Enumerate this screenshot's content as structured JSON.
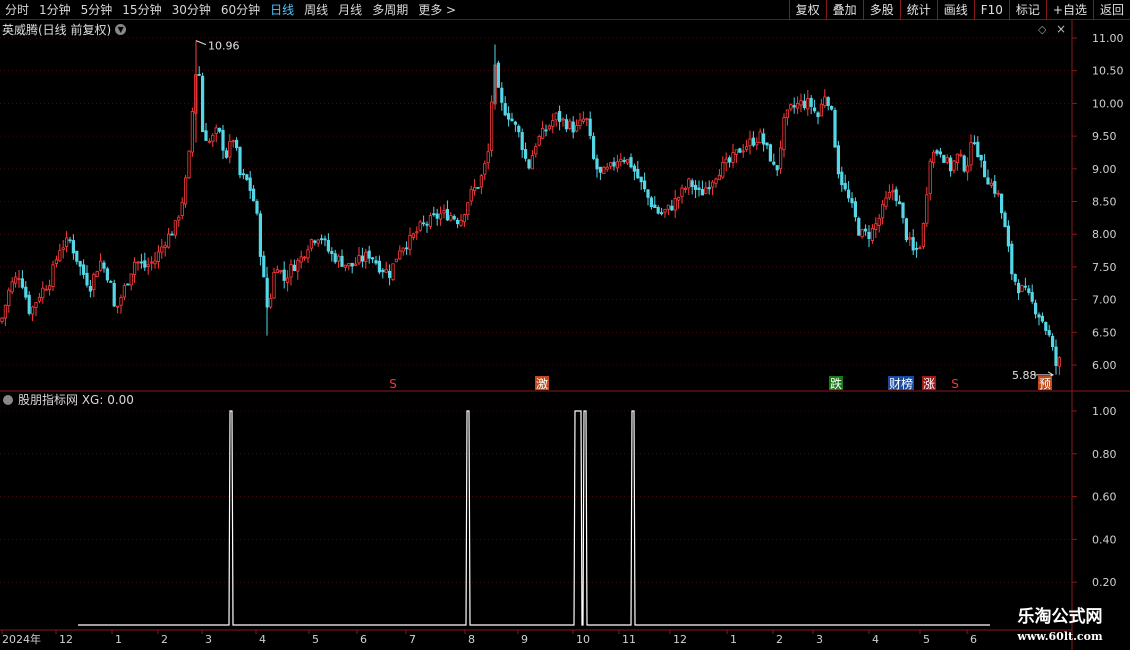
{
  "toolbar": {
    "periods": [
      "分时",
      "1分钟",
      "5分钟",
      "15分钟",
      "30分钟",
      "60分钟",
      "日线",
      "周线",
      "月线",
      "多周期",
      "更多 >"
    ],
    "active_period": "日线",
    "right_buttons": [
      "复权",
      "叠加",
      "多股",
      "统计",
      "画线",
      "F10",
      "标记",
      "+自选",
      "返回"
    ]
  },
  "main_chart": {
    "title": "英威腾(日线 前复权)",
    "y_ticks": [
      "11.00",
      "10.50",
      "10.00",
      "9.50",
      "9.00",
      "8.50",
      "8.00",
      "7.50",
      "7.00",
      "6.50",
      "6.00"
    ],
    "high_label": "10.96",
    "low_label": "5.88",
    "markers": [
      {
        "text": "S",
        "color": "#ff3333",
        "bg": "none"
      },
      {
        "text": "激",
        "color": "#ffffff",
        "bg": "#c04a1a"
      },
      {
        "text": "跌",
        "color": "#ffffff",
        "bg": "#1a7a1a"
      },
      {
        "text": "财榜",
        "color": "#ffffff",
        "bg": "#1a4aa0"
      },
      {
        "text": "涨",
        "color": "#ffffff",
        "bg": "#a01a1a"
      },
      {
        "text": "S",
        "color": "#ff3333",
        "bg": "none"
      },
      {
        "text": "预",
        "color": "#ffffff",
        "bg": "#c04a1a"
      }
    ],
    "up_color": "#ff3c3c",
    "down_color": "#54d8e8"
  },
  "indicator": {
    "title": "股朋指标网 XG: 0.00",
    "y_ticks": [
      "1.00",
      "0.80",
      "0.60",
      "0.40",
      "0.20"
    ]
  },
  "x_axis": {
    "labels": [
      "2024年",
      "12",
      "1",
      "2",
      "3",
      "4",
      "5",
      "6",
      "7",
      "8",
      "9",
      "10",
      "11",
      "12",
      "1",
      "2",
      "3",
      "4",
      "5",
      "6"
    ]
  },
  "watermark": {
    "line1": "乐淘公式网",
    "line2": "www.60lt.com"
  }
}
